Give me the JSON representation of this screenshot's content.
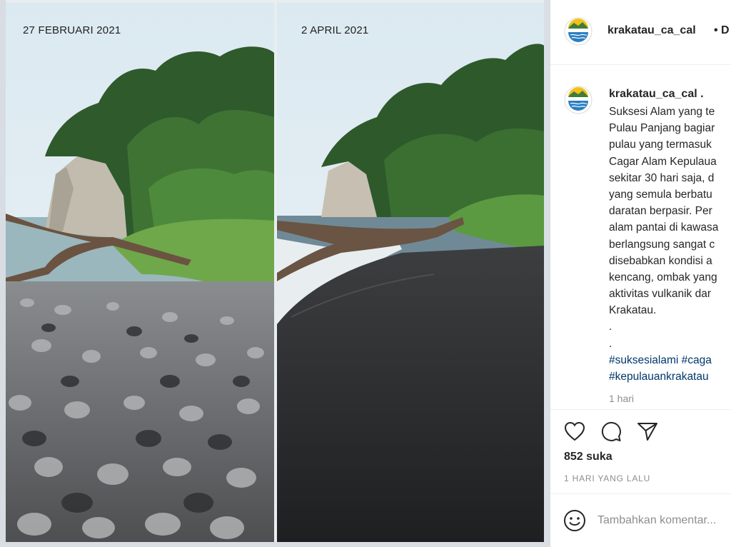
{
  "photos": [
    {
      "date_label": "27 FEBRUARI 2021"
    },
    {
      "date_label": "2 APRIL 2021"
    }
  ],
  "header": {
    "username": "krakatau_ca_cal",
    "follow_label": "• D"
  },
  "caption": {
    "username": "krakatau_ca_cal .",
    "lines": [
      "Suksesi Alam yang te",
      "Pulau Panjang bagiar",
      "pulau yang termasuk",
      "Cagar Alam Kepulaua",
      "sekitar 30 hari saja, d",
      "yang semula berbatu",
      "daratan berpasir. Per",
      "alam pantai di kawasa",
      "berlangsung sangat c",
      "disebabkan kondisi a",
      "kencang, ombak yang",
      "aktivitas vulkanik dar",
      "Krakatau.",
      ".",
      "."
    ],
    "hashtag_line_1": "#suksesialami #caga",
    "hashtag_line_2": "#kepulauankrakatau",
    "time": "1 hari"
  },
  "actions": {
    "like_icon": "heart-icon",
    "comment_icon": "comment-icon",
    "share_icon": "send-icon"
  },
  "likes": "852 suka",
  "posted": "1 HARI YANG LALU",
  "comment": {
    "placeholder": "Tambahkan komentar...",
    "emoji_icon": "smiley-icon"
  },
  "colors": {
    "text": "#262626",
    "muted": "#8e8e8e",
    "hashtag": "#00376b",
    "divider": "#efefef"
  }
}
